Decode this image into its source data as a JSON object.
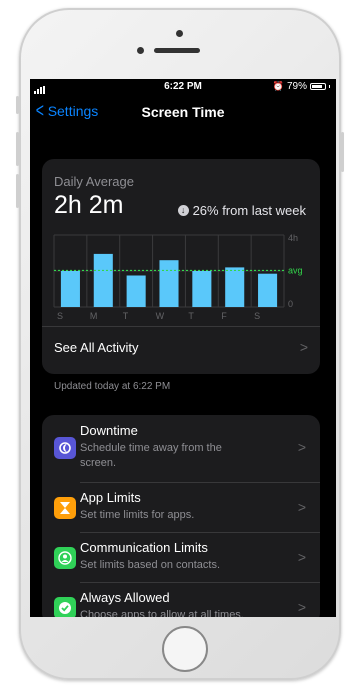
{
  "status_bar": {
    "time": "6:22 PM",
    "battery": "79%"
  },
  "nav": {
    "back_label": "Settings",
    "title": "Screen Time"
  },
  "summary": {
    "label": "Daily Average",
    "value": "2h 2m",
    "trend": "26% from last week",
    "see_all": "See All Activity",
    "updated": "Updated today at 6:22 PM"
  },
  "chart_data": {
    "type": "bar",
    "categories": [
      "S",
      "M",
      "T",
      "W",
      "T",
      "F",
      "S"
    ],
    "values": [
      2.0,
      2.95,
      1.75,
      2.6,
      2.0,
      2.2,
      1.85
    ],
    "ylim": [
      0,
      4
    ],
    "y_tick_labels": [
      "4h",
      "0"
    ],
    "average": 2.03,
    "average_label": "avg",
    "bar_color": "#5ac8fa",
    "avg_color": "#32d74b",
    "grid": true
  },
  "settings": [
    {
      "title": "Downtime",
      "subtitle": "Schedule time away from the screen.",
      "icon": "moon-icon",
      "color": "#5856d6"
    },
    {
      "title": "App Limits",
      "subtitle": "Set time limits for apps.",
      "icon": "hourglass-icon",
      "color": "#ff9f0a"
    },
    {
      "title": "Communication Limits",
      "subtitle": "Set limits based on contacts.",
      "icon": "contact-icon",
      "color": "#30d158"
    },
    {
      "title": "Always Allowed",
      "subtitle": "Choose apps to allow at all times.",
      "icon": "checkmark-icon",
      "color": "#30d158"
    }
  ]
}
